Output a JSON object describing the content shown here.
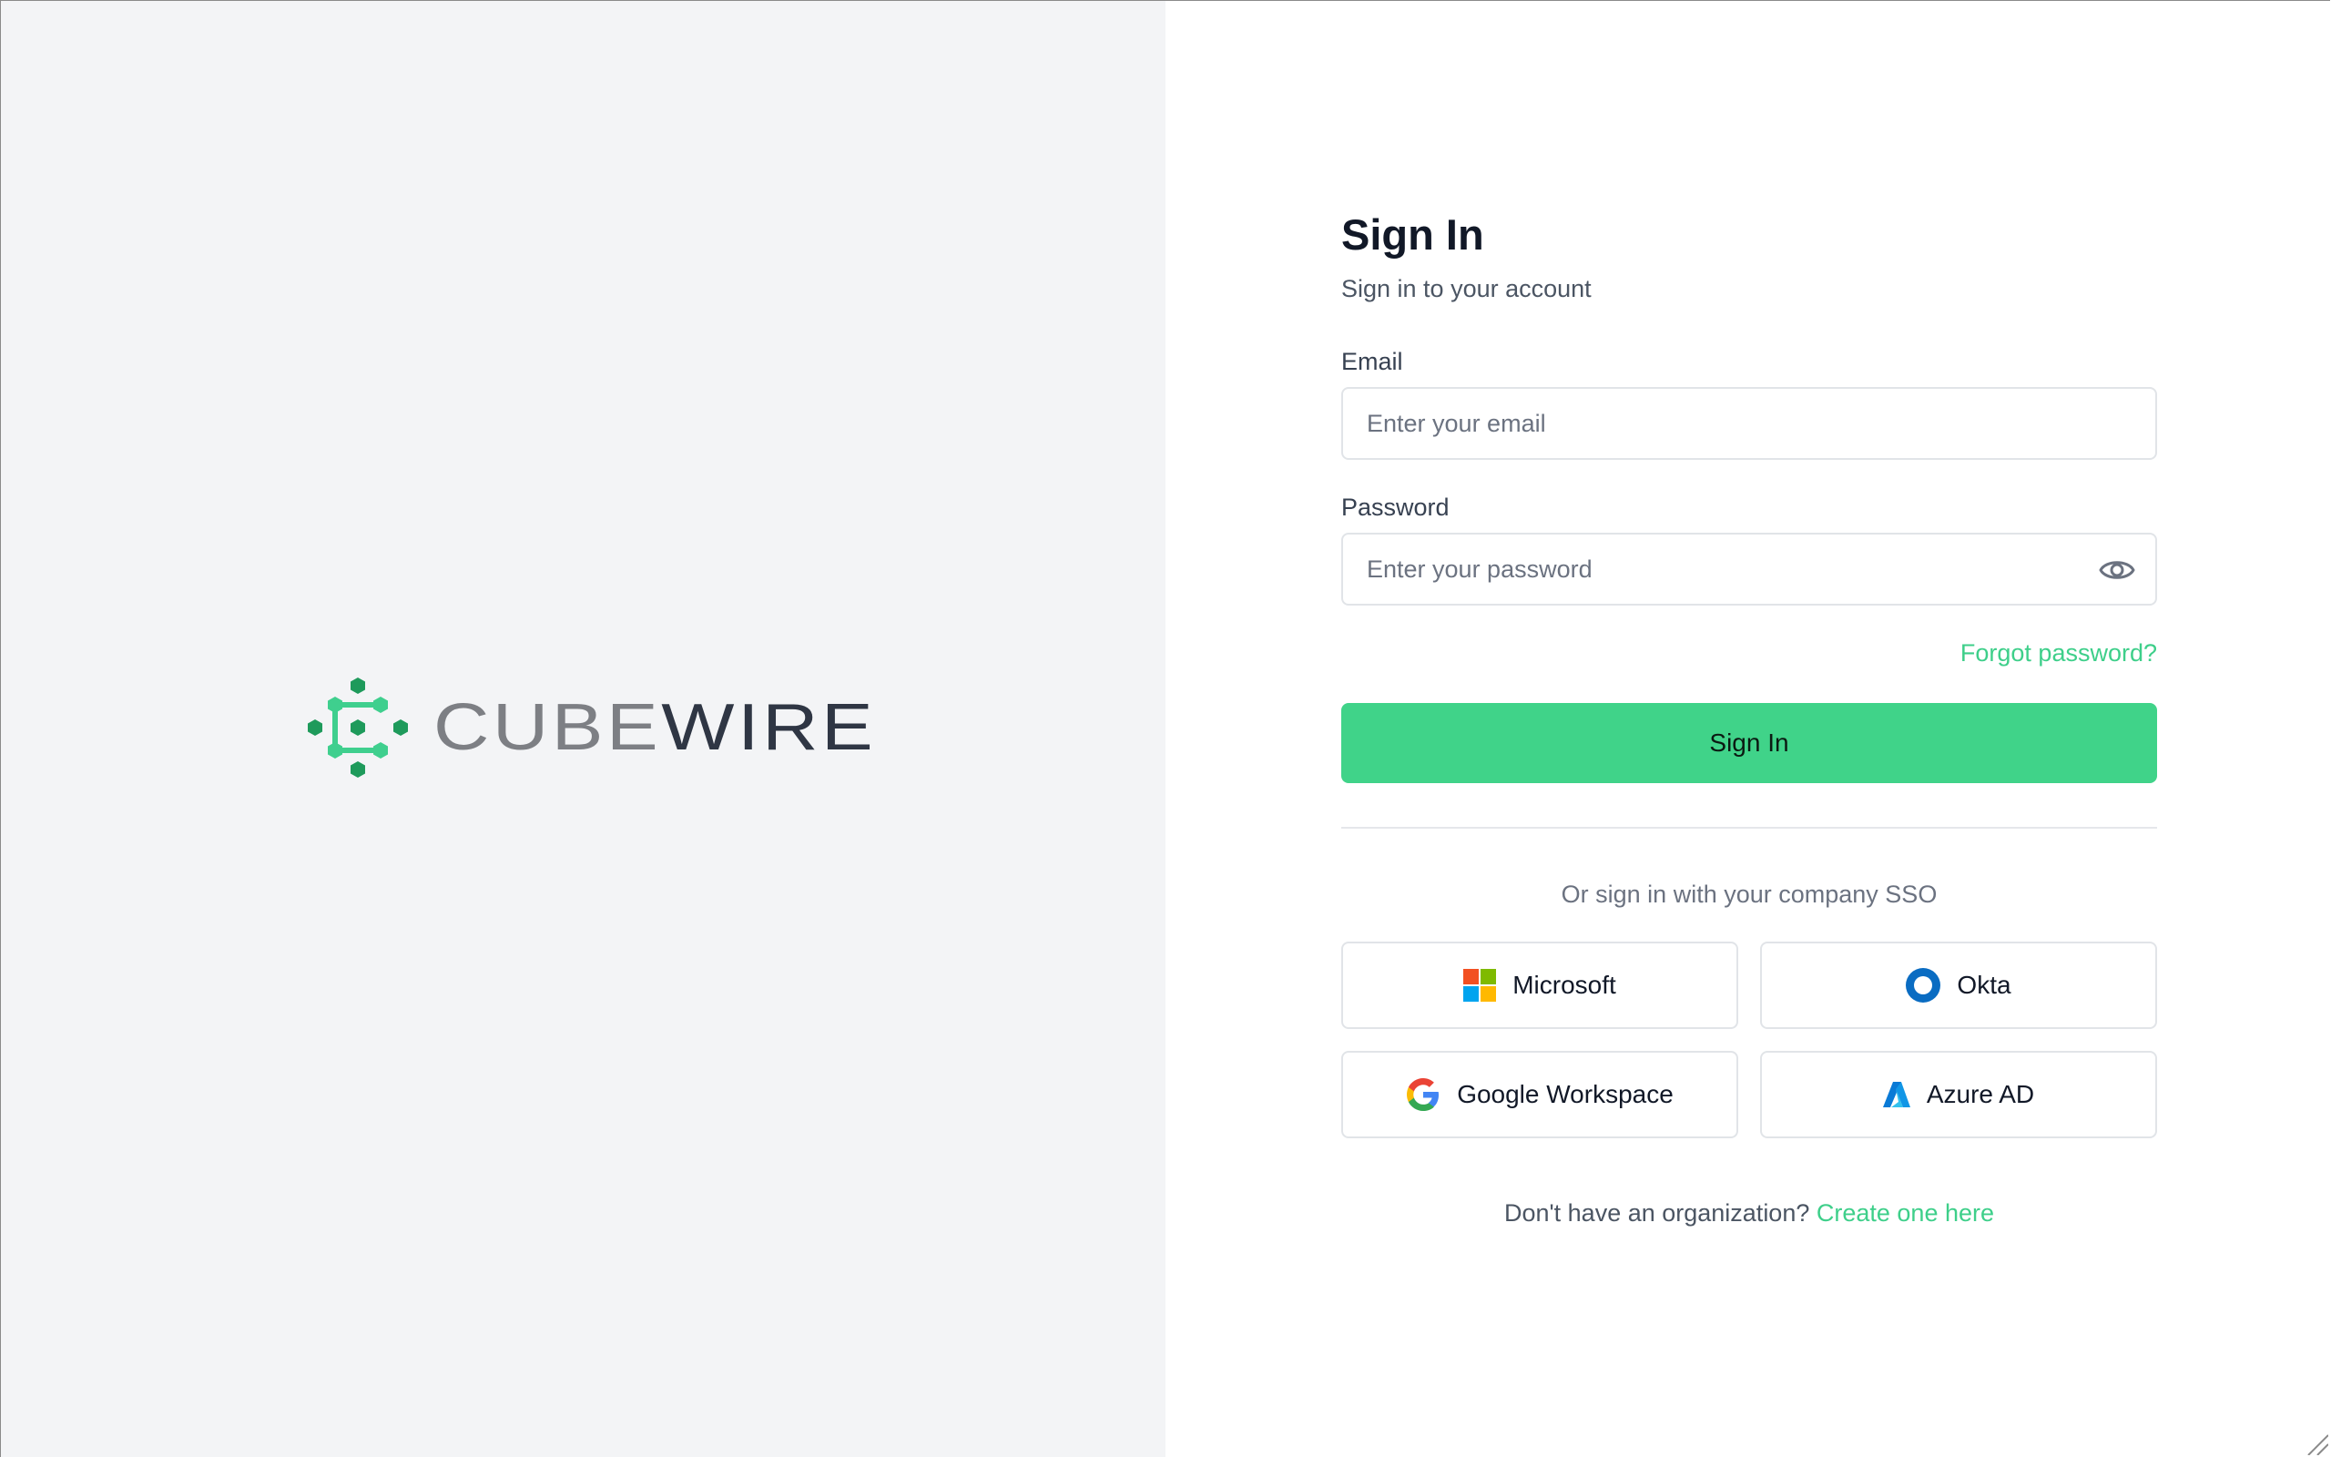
{
  "brand": {
    "name_part1": "CUBE",
    "name_part2": "WIRE",
    "accent_color": "#40d389"
  },
  "signin": {
    "title": "Sign In",
    "subtitle": "Sign in to your account",
    "email_label": "Email",
    "email_placeholder": "Enter your email",
    "email_value": "",
    "password_label": "Password",
    "password_placeholder": "Enter your password",
    "password_value": "",
    "password_toggle_icon": "eye-icon",
    "forgot_link": "Forgot password?",
    "submit_label": "Sign In"
  },
  "sso": {
    "prompt": "Or sign in with your company SSO",
    "providers": [
      {
        "label": "Microsoft",
        "icon": "microsoft-icon"
      },
      {
        "label": "Okta",
        "icon": "okta-icon"
      },
      {
        "label": "Google Workspace",
        "icon": "google-icon"
      },
      {
        "label": "Azure AD",
        "icon": "azure-icon"
      }
    ]
  },
  "footer": {
    "prompt": "Don't have an organization?",
    "link": "Create one here"
  }
}
